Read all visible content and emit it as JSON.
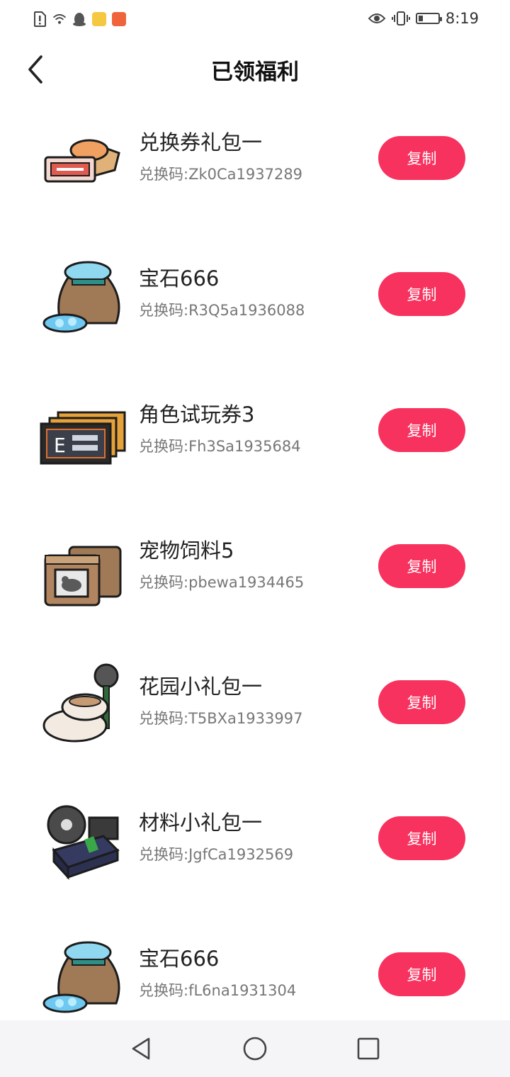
{
  "status_bar": {
    "time": "8:19",
    "icons_left": [
      "sim-alert-icon",
      "wifi-icon",
      "qq-penguin-icon",
      "notes-icon",
      "app-notification-icon"
    ],
    "icons_right": [
      "eye-comfort-icon",
      "vibrate-icon",
      "battery-icon"
    ],
    "battery_level_percent": 25,
    "colors": {
      "notes_chip": "#f5c842",
      "app_chip": "#f0643c"
    }
  },
  "header": {
    "title": "已领福利",
    "back_icon": "chevron-left-icon"
  },
  "items": [
    {
      "name": "兑换券礼包一",
      "code_label": "兑换码:Zk0Ca1937289",
      "icon": "coupon-pack-icon",
      "button": "复制"
    },
    {
      "name": "宝石666",
      "code_label": "兑换码:R3Q5a1936088",
      "icon": "gem-bag-icon",
      "button": "复制"
    },
    {
      "name": "角色试玩券3",
      "code_label": "兑换码:Fh3Sa1935684",
      "icon": "trial-ticket-icon",
      "button": "复制"
    },
    {
      "name": "宠物饲料5",
      "code_label": "兑换码:pbewa1934465",
      "icon": "pet-food-icon",
      "button": "复制"
    },
    {
      "name": "花园小礼包一",
      "code_label": "兑换码:T5BXa1933997",
      "icon": "garden-pack-icon",
      "button": "复制"
    },
    {
      "name": "材料小礼包一",
      "code_label": "兑换码:JgfCa1932569",
      "icon": "material-pack-icon",
      "button": "复制"
    },
    {
      "name": "宝石666",
      "code_label": "兑换码:fL6na1931304",
      "icon": "gem-bag-icon",
      "button": "复制"
    }
  ],
  "nav": {
    "buttons": [
      "back-triangle-icon",
      "home-circle-icon",
      "recents-square-icon"
    ]
  },
  "colors": {
    "accent": "#f7325e",
    "nav_bg": "#f5f5f7"
  }
}
